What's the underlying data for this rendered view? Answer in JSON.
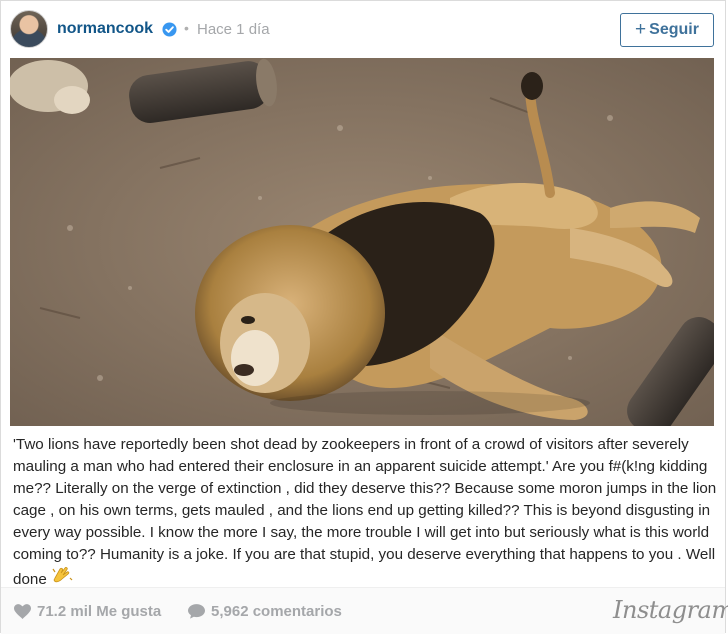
{
  "post": {
    "username": "normancook",
    "separator": "•",
    "time": "Hace 1 día",
    "follow_label": "Seguir",
    "follow_icon": "plus-icon",
    "verified_icon": "verified-badge-icon"
  },
  "photo": {
    "subject": "lion-photo"
  },
  "caption": {
    "text": "'Two lions have reportedly been shot dead by zookeepers in front of a crowd of visitors after severely mauling a man who had entered their enclosure in an apparent suicide attempt.' Are you f#(k!ng kidding me?? Literally on the verge of extinction , did they deserve this?? Because some moron jumps in the lion cage , on his own terms, gets mauled , and the lions end up getting killed?? This is beyond disgusting in every way possible. I know the more I say, the more trouble I will get into but seriously what is this world coming to?? Humanity is a joke. If you are that stupid, you deserve everything that happens to you . Well done",
    "emoji_icon": "clapping-hands-icon"
  },
  "footer": {
    "likes": "71.2 mil Me gusta",
    "comments": "5,962 comentarios",
    "brand": "Instagram",
    "like_icon": "heart-icon",
    "comment_icon": "comment-bubble-icon"
  },
  "colors": {
    "username": "#125688",
    "follow": "#3f729b",
    "muted": "#a5a7aa",
    "verified": "#3897f0"
  }
}
